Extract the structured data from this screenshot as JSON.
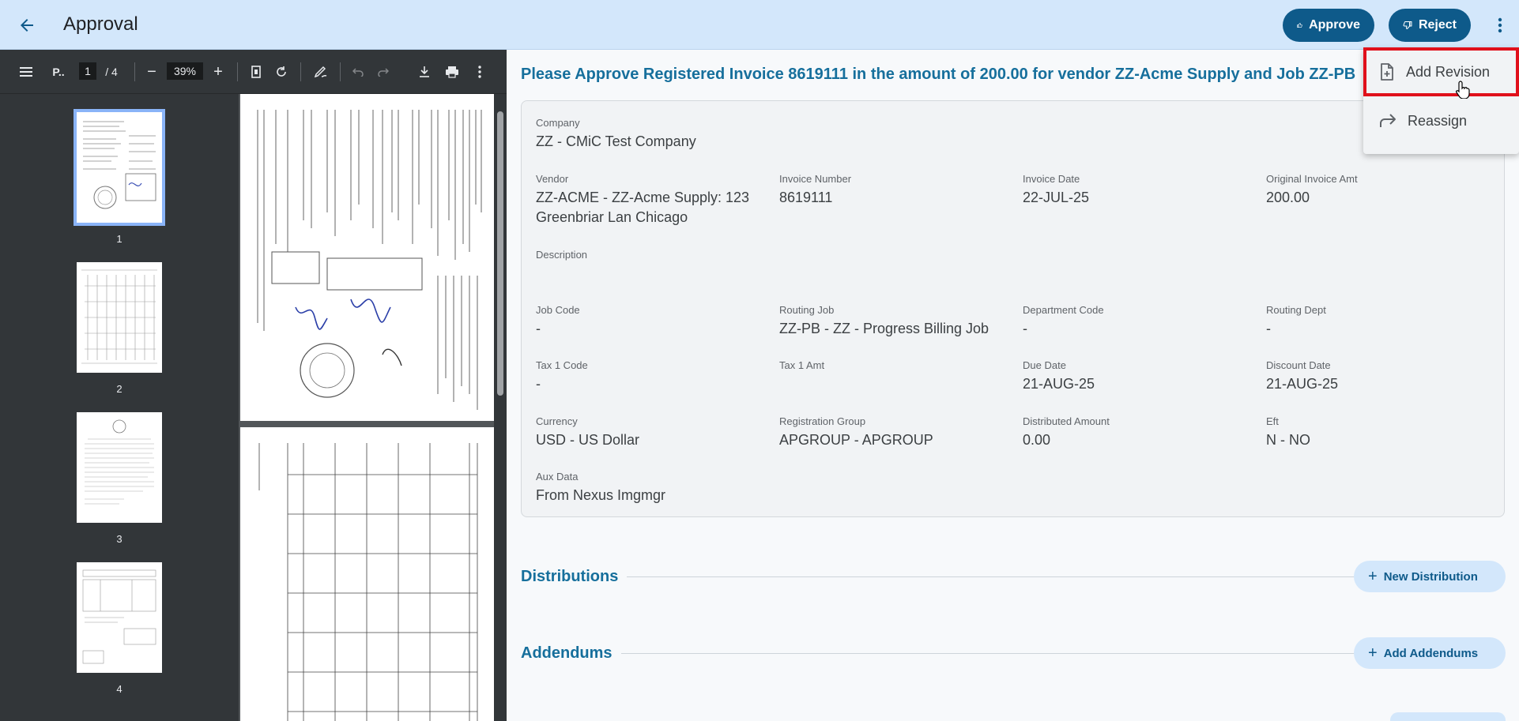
{
  "header": {
    "title": "Approval",
    "approve_label": "Approve",
    "reject_label": "Reject"
  },
  "pdf_toolbar": {
    "doc_name": "P..",
    "current_page": "1",
    "page_total": "/ 4",
    "zoom": "39%"
  },
  "thumbnails": [
    {
      "label": "1"
    },
    {
      "label": "2"
    },
    {
      "label": "3"
    },
    {
      "label": "4"
    }
  ],
  "main": {
    "title": "Please Approve Registered Invoice 8619111 in the amount of 200.00 for vendor ZZ-Acme Supply and Job ZZ-PB",
    "fields": {
      "company": {
        "label": "Company",
        "value": "ZZ - CMiC Test Company"
      },
      "vendor": {
        "label": "Vendor",
        "value_line1": "ZZ-ACME - ZZ-Acme Supply: 123",
        "value_line2": "Greenbriar Lan Chicago"
      },
      "invoice_number": {
        "label": "Invoice Number",
        "value": "8619111"
      },
      "invoice_date": {
        "label": "Invoice Date",
        "value": "22-JUL-25"
      },
      "original_invoice_amt": {
        "label": "Original Invoice Amt",
        "value": "200.00"
      },
      "description": {
        "label": "Description",
        "value": ""
      },
      "job_code": {
        "label": "Job Code",
        "value": "-"
      },
      "routing_job": {
        "label": "Routing Job",
        "value": "ZZ-PB - ZZ - Progress Billing Job"
      },
      "department_code": {
        "label": "Department Code",
        "value": "-"
      },
      "routing_dept": {
        "label": "Routing Dept",
        "value": "-"
      },
      "tax1_code": {
        "label": "Tax 1 Code",
        "value": "-"
      },
      "tax1_amt": {
        "label": "Tax 1 Amt",
        "value": ""
      },
      "due_date": {
        "label": "Due Date",
        "value": "21-AUG-25"
      },
      "discount_date": {
        "label": "Discount Date",
        "value": "21-AUG-25"
      },
      "currency": {
        "label": "Currency",
        "value": "USD - US Dollar"
      },
      "registration_group": {
        "label": "Registration Group",
        "value": "APGROUP - APGROUP"
      },
      "distributed_amount": {
        "label": "Distributed Amount",
        "value": "0.00"
      },
      "eft": {
        "label": "Eft",
        "value": "N - NO"
      },
      "aux_data": {
        "label": "Aux Data",
        "value": "From Nexus Imgmgr"
      }
    },
    "distributions": {
      "title": "Distributions",
      "button": "New Distribution"
    },
    "addendums": {
      "title": "Addendums",
      "button": "Add Addendums"
    }
  },
  "menu": {
    "items": [
      {
        "label": "Add Revision",
        "icon": "file-plus-icon"
      },
      {
        "label": "Reassign",
        "icon": "forward-arrow-icon"
      }
    ]
  },
  "colors": {
    "header_bg": "#d3e7fb",
    "primary": "#0e5a8a",
    "accent_text": "#166f9c",
    "highlight": "#e0101b"
  }
}
